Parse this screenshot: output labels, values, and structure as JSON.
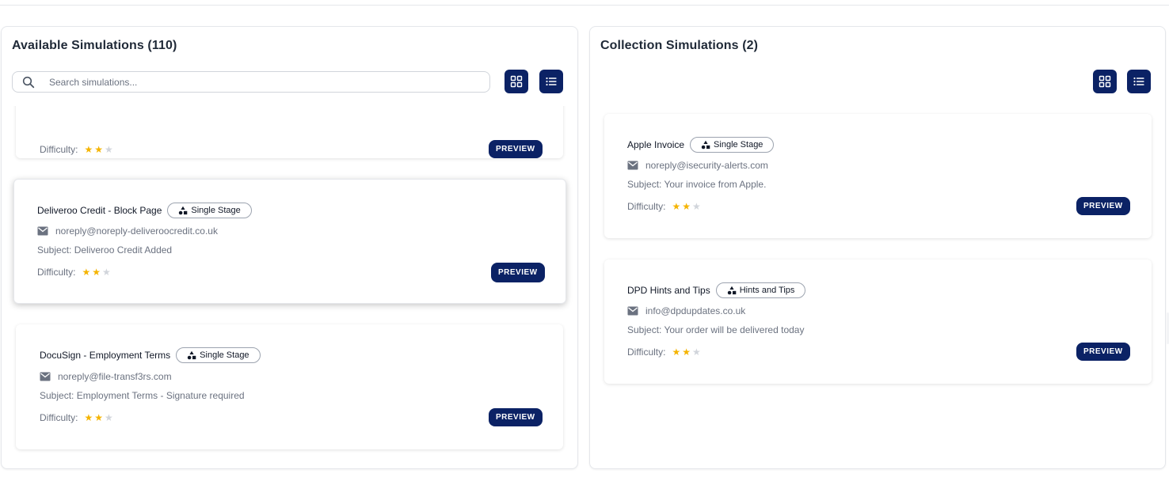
{
  "available": {
    "title": "Available Simulations (110)",
    "search_placeholder": "Search simulations...",
    "cards": [
      {
        "name": "",
        "badge": "",
        "sender": "",
        "subject": "",
        "difficulty_label": "Difficulty:",
        "difficulty": 2,
        "preview_label": "PREVIEW"
      },
      {
        "name": "Deliveroo Credit - Block Page",
        "badge": "Single Stage",
        "sender": "noreply@noreply-deliveroocredit.co.uk",
        "subject": "Subject: Deliveroo Credit Added",
        "difficulty_label": "Difficulty:",
        "difficulty": 2,
        "preview_label": "PREVIEW"
      },
      {
        "name": "DocuSign - Employment Terms",
        "badge": "Single Stage",
        "sender": "noreply@file-transf3rs.com",
        "subject": "Subject: Employment Terms - Signature required",
        "difficulty_label": "Difficulty:",
        "difficulty": 2,
        "preview_label": "PREVIEW"
      }
    ]
  },
  "collection": {
    "title": "Collection Simulations (2)",
    "cards": [
      {
        "name": "Apple Invoice",
        "badge": "Single Stage",
        "sender": "noreply@isecurity-alerts.com",
        "subject": "Subject: Your invoice from Apple.",
        "difficulty_label": "Difficulty:",
        "difficulty": 2,
        "preview_label": "PREVIEW"
      },
      {
        "name": "DPD Hints and Tips",
        "badge": "Hints and Tips",
        "sender": "info@dpdupdates.co.uk",
        "subject": "Subject: Your order will be delivered today",
        "difficulty_label": "Difficulty:",
        "difficulty": 2,
        "preview_label": "PREVIEW"
      }
    ]
  },
  "icons": {
    "search": "search-icon",
    "grid_view": "grid-view-icon",
    "list_view": "list-view-icon",
    "envelope": "envelope-icon",
    "stage": "shapes-icon",
    "star": "star-icon"
  },
  "colors": {
    "primary": "#0b2265",
    "star_on": "#f5b400",
    "star_off": "#d1d5db",
    "muted_text": "#6b7280"
  }
}
